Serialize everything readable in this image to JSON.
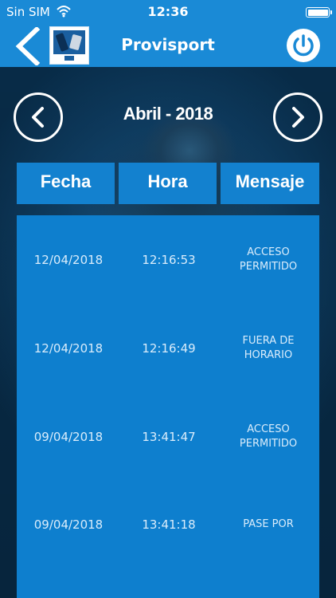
{
  "status_bar": {
    "carrier": "Sin SIM",
    "time": "12:36",
    "battery_level": 1.0
  },
  "nav": {
    "title": "Provisport",
    "back_icon": "chevron-left-icon",
    "logo": "app-logo",
    "power_icon": "power-icon"
  },
  "month": {
    "label": "Abril - 2018"
  },
  "table": {
    "headers": [
      "Fecha",
      "Hora",
      "Mensaje"
    ],
    "rows": [
      {
        "fecha": "12/04/2018",
        "hora": "12:16:53",
        "mensaje": "ACCESO PERMITIDO"
      },
      {
        "fecha": "12/04/2018",
        "hora": "12:16:49",
        "mensaje": "FUERA DE HORARIO"
      },
      {
        "fecha": "09/04/2018",
        "hora": "13:41:47",
        "mensaje": "ACCESO PERMITIDO"
      },
      {
        "fecha": "09/04/2018",
        "hora": "13:41:18",
        "mensaje": "PASE POR"
      }
    ]
  },
  "colors": {
    "accent": "#1a8ad6",
    "table_bg": "#0e7fce",
    "header_bg": "#1381cf"
  }
}
